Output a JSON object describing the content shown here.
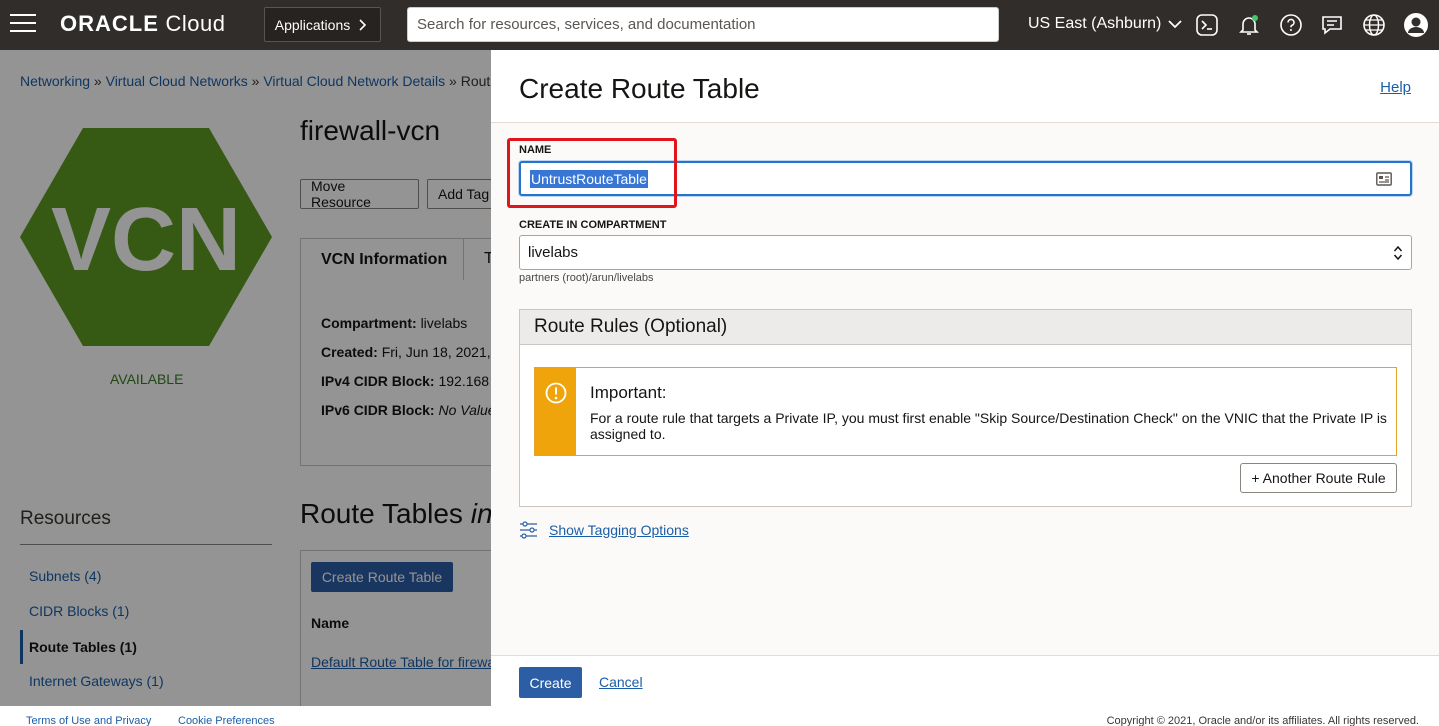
{
  "topbar": {
    "brand_bold": "ORACLE",
    "brand_rest": " Cloud",
    "applications_label": "Applications",
    "search_placeholder": "Search for resources, services, and documentation",
    "region_label": "US East (Ashburn)"
  },
  "background": {
    "breadcrumb": {
      "networking": "Networking",
      "vcns": "Virtual Cloud Networks",
      "vcn_details": "Virtual Cloud Network Details",
      "current": "Rout",
      "separator": " » "
    },
    "vcn_badge_text": "VCN",
    "status": "AVAILABLE",
    "vcn_name": "firewall-vcn",
    "move_resource_label": "Move Resource",
    "add_tags_label": "Add Tag",
    "info_tab_label": "VCN Information",
    "info_tab2_label": "T",
    "info": {
      "compartment_label": "Compartment:",
      "compartment_value": "livelabs",
      "created_label": "Created:",
      "created_value": "Fri, Jun 18, 2021,",
      "ipv4_label": "IPv4 CIDR Block:",
      "ipv4_value": "192.168",
      "ipv6_label": "IPv6 CIDR Block:",
      "ipv6_value": "No Value"
    },
    "resources_heading": "Resources",
    "resources": [
      {
        "label": "Subnets (4)"
      },
      {
        "label": "CIDR Blocks (1)"
      },
      {
        "label": "Route Tables (1)"
      },
      {
        "label": "Internet Gateways (1)"
      }
    ],
    "route_tables_heading": "Route Tables",
    "route_tables_heading_tail": "in",
    "create_route_table_label": "Create Route Table",
    "name_column": "Name",
    "default_route_table": "Default Route Table for firewa",
    "footer": {
      "terms": "Terms of Use and Privacy",
      "cookies": "Cookie Preferences",
      "copyright": "Copyright © 2021, Oracle and/or its affiliates. All rights reserved."
    }
  },
  "dialog": {
    "title": "Create Route Table",
    "help_label": "Help",
    "name_label": "NAME",
    "name_value": "UntrustRouteTable",
    "compartment_label": "CREATE IN COMPARTMENT",
    "compartment_value": "livelabs",
    "compartment_path": "partners (root)/arun/livelabs",
    "route_rules_heading": "Route Rules (Optional)",
    "alert_title": "Important:",
    "alert_text": "For a route rule that targets a Private IP, you must first enable \"Skip Source/Destination Check\" on the VNIC that the Private IP is assigned to.",
    "another_rule_label": "+ Another Route Rule",
    "tagging_label": "Show Tagging Options",
    "create_label": "Create",
    "cancel_label": "Cancel"
  },
  "colors": {
    "topbar_bg": "#312d2a",
    "primary_button": "#2c5ea5",
    "link": "#1b5ea8",
    "vcn_hex_green": "#5e9b23",
    "alert_orange": "#f0a40c",
    "highlight_red": "#e0161c"
  },
  "icons": [
    "hamburger-icon",
    "chevron-right-icon",
    "chevron-down-icon",
    "cloud-shell-icon",
    "bell-icon",
    "help-icon",
    "chat-icon",
    "globe-icon",
    "user-icon",
    "contact-card-icon",
    "select-arrows-icon",
    "warning-icon",
    "tag-sliders-icon"
  ]
}
